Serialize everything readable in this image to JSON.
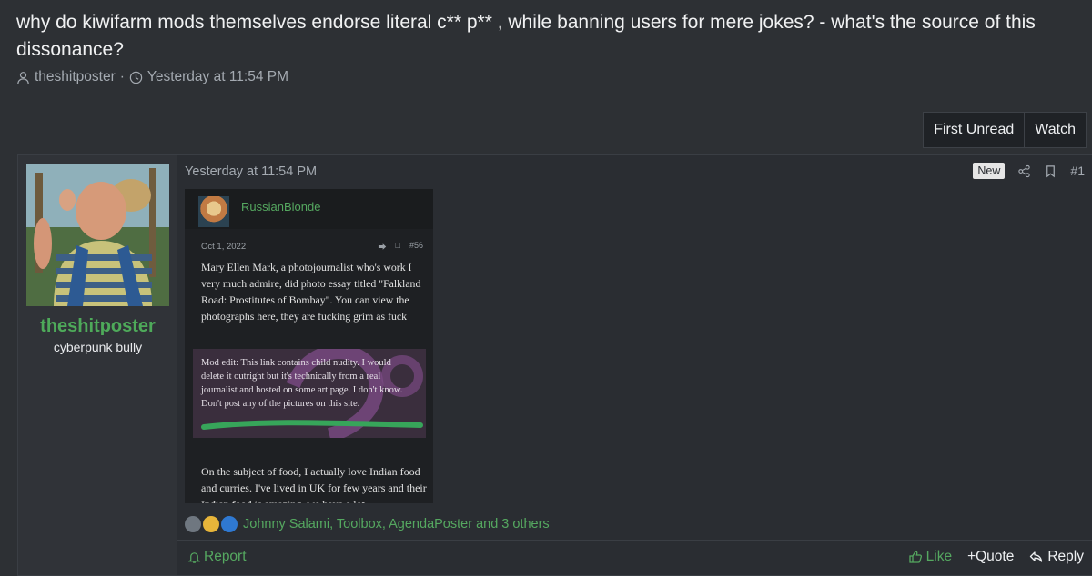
{
  "thread": {
    "title": "why do kiwifarm mods themselves endorse literal c** p** , while banning users for mere jokes? - what's the source of this dissonance?",
    "author": "theshitposter",
    "separator": "·",
    "time": "Yesterday at 11:54 PM"
  },
  "actions": {
    "first_unread": "First Unread",
    "watch": "Watch"
  },
  "post": {
    "username": "theshitposter",
    "user_title": "cyberpunk bully",
    "date": "Yesterday at 11:54 PM",
    "new_badge": "New",
    "post_number": "#1",
    "embed": {
      "name": "RussianBlonde",
      "date": "Oct 1, 2022",
      "post_number": "#56",
      "text": "Mary Ellen Mark, a photojournalist who's work I very much admire, did photo essay titled \"Falkland Road: Prostitutes of Bombay\". You can view the photographs here, they are fucking grim as fuck",
      "mod_edit": "Mod edit: This link contains child nudity. I would delete it outright but it's technically from a real journalist and hosted on some art page. I don't know. Don't post any of the pictures on this site.",
      "bottom_text": "On the subject of food, I actually love Indian food and curries. I've lived in UK for few years and their Indian food is amazing, we have a lot"
    },
    "reactions": "Johnny Salami, Toolbox, AgendaPoster and 3 others",
    "footer": {
      "report": "Report",
      "like": "Like",
      "quote": "+Quote",
      "reply": "Reply"
    }
  },
  "colors": {
    "accent_green": "#55a860",
    "username_green": "#4eaa5a",
    "background": "#2d3034"
  }
}
